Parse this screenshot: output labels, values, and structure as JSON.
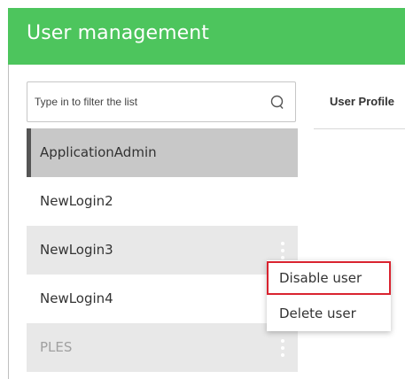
{
  "header": {
    "title": "User management"
  },
  "search": {
    "placeholder": "Type in to filter the list",
    "icon": "search-icon"
  },
  "tabs": [
    {
      "label": "User Profile"
    }
  ],
  "users": [
    {
      "name": "ApplicationAdmin",
      "state": "selected"
    },
    {
      "name": "NewLogin2",
      "state": "normal"
    },
    {
      "name": "NewLogin3",
      "state": "hovered"
    },
    {
      "name": "NewLogin4",
      "state": "normal"
    },
    {
      "name": "PLES",
      "state": "disabled"
    }
  ],
  "context_menu": {
    "items": [
      {
        "label": "Disable user",
        "highlighted": true
      },
      {
        "label": "Delete user",
        "highlighted": false
      }
    ]
  },
  "colors": {
    "header_bg": "#4dc55d",
    "highlight_border": "#d9232f",
    "selected_bg": "#c8c8c8",
    "hover_bg": "#e8e8e8"
  }
}
